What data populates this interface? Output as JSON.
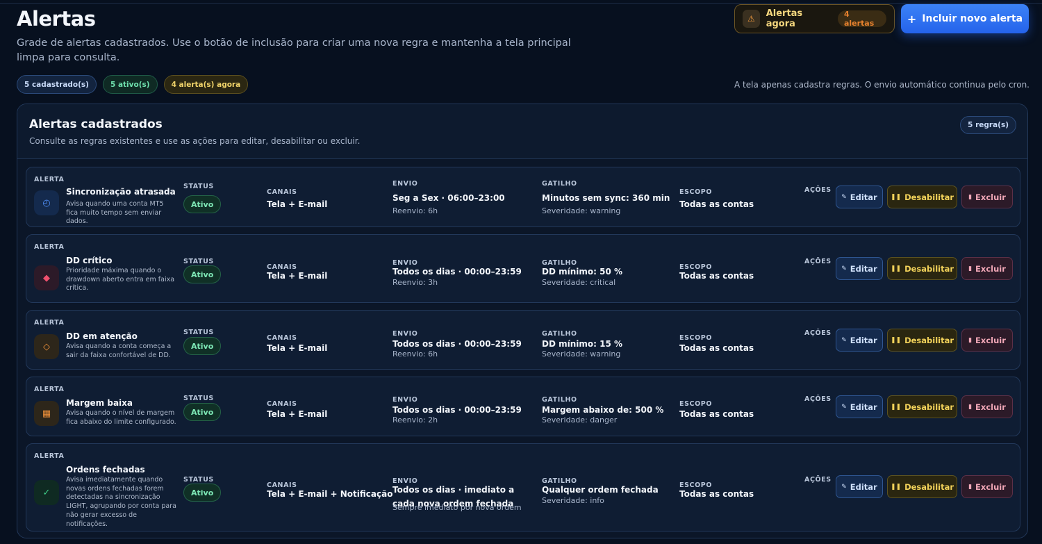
{
  "header": {
    "title": "Alertas",
    "description": "Grade de alertas cadastrados. Use o botão de inclusão para criar uma nova regra e mantenha a tela principal limpa para consulta.",
    "chips": [
      "5 cadastrado(s)",
      "5 ativo(s)",
      "4 alerta(s) agora"
    ],
    "note": "A tela apenas cadastra regras. O envio automático continua pelo cron.",
    "alerts_now": {
      "icon": "warning-icon",
      "label": "Alertas agora",
      "count": "4 alertas"
    },
    "new_button": {
      "icon": "plus-icon",
      "label": "Incluir novo alerta"
    }
  },
  "panel": {
    "title": "Alertas cadastrados",
    "subtitle": "Consulte as regras existentes e use as ações para editar, desabilitar ou excluir.",
    "count_chip": "5 regra(s)",
    "labels": {
      "alerta": "ALERTA",
      "status": "STATUS",
      "canais": "CANAIS",
      "envio": "ENVIO",
      "gatilho": "GATILHO",
      "escopo": "ESCOPO",
      "acoes": "AÇÕES"
    },
    "actions": {
      "edit": "Editar",
      "disable": "Desabilitar",
      "delete": "Excluir"
    },
    "rows": [
      {
        "icon": "clock-icon",
        "icon_color": "#4f8df5",
        "name": "Sincronização atrasada",
        "desc": "Avisa quando uma conta MT5 fica muito tempo sem enviar dados.",
        "status": "Ativo",
        "channels": "Tela + E-mail",
        "send": "Seg a Sex · 06:00–23:00",
        "resend": "Reenvio: 6h",
        "trigger": "Minutos sem sync: 360 min",
        "severity": "Severidade: warning",
        "scope": "Todas as contas"
      },
      {
        "icon": "diamond-icon",
        "icon_color": "#f0506e",
        "name": "DD crítico",
        "desc": "Prioridade máxima quando o drawdown aberto entra em faixa crítica.",
        "status": "Ativo",
        "channels": "Tela + E-mail",
        "send": "Todos os dias · 00:00–23:59",
        "resend": "Reenvio: 3h",
        "trigger": "DD mínimo: 50 %",
        "severity": "Severidade: critical",
        "scope": "Todas as contas"
      },
      {
        "icon": "diamond-outline-icon",
        "icon_color": "#f0913a",
        "name": "DD em atenção",
        "desc": "Avisa quando a conta começa a sair da faixa confortável de DD.",
        "status": "Ativo",
        "channels": "Tela + E-mail",
        "send": "Todos os dias · 00:00–23:59",
        "resend": "Reenvio: 6h",
        "trigger": "DD mínimo: 15 %",
        "severity": "Severidade: warning",
        "scope": "Todas as contas"
      },
      {
        "icon": "bar-icon",
        "icon_color": "#f0913a",
        "name": "Margem baixa",
        "desc": "Avisa quando o nível de margem fica abaixo do limite configurado.",
        "status": "Ativo",
        "channels": "Tela + E-mail",
        "send": "Todos os dias · 00:00–23:59",
        "resend": "Reenvio: 2h",
        "trigger": "Margem abaixo de: 500 %",
        "severity": "Severidade: danger",
        "scope": "Todas as contas"
      },
      {
        "icon": "check-icon",
        "icon_color": "#3fd18a",
        "name": "Ordens fechadas",
        "desc": "Avisa imediatamente quando novas ordens fechadas forem detectadas na sincronização LIGHT, agrupando por conta para não gerar excesso de notificações.",
        "status": "Ativo",
        "channels": "Tela + E-mail + Notificação",
        "send": "Todos os dias · imediato a cada nova ordem fechada",
        "resend": "Sempre imediato por nova ordem",
        "trigger": "Qualquer ordem fechada",
        "severity": "Severidade: info",
        "scope": "Todas as contas"
      }
    ]
  }
}
